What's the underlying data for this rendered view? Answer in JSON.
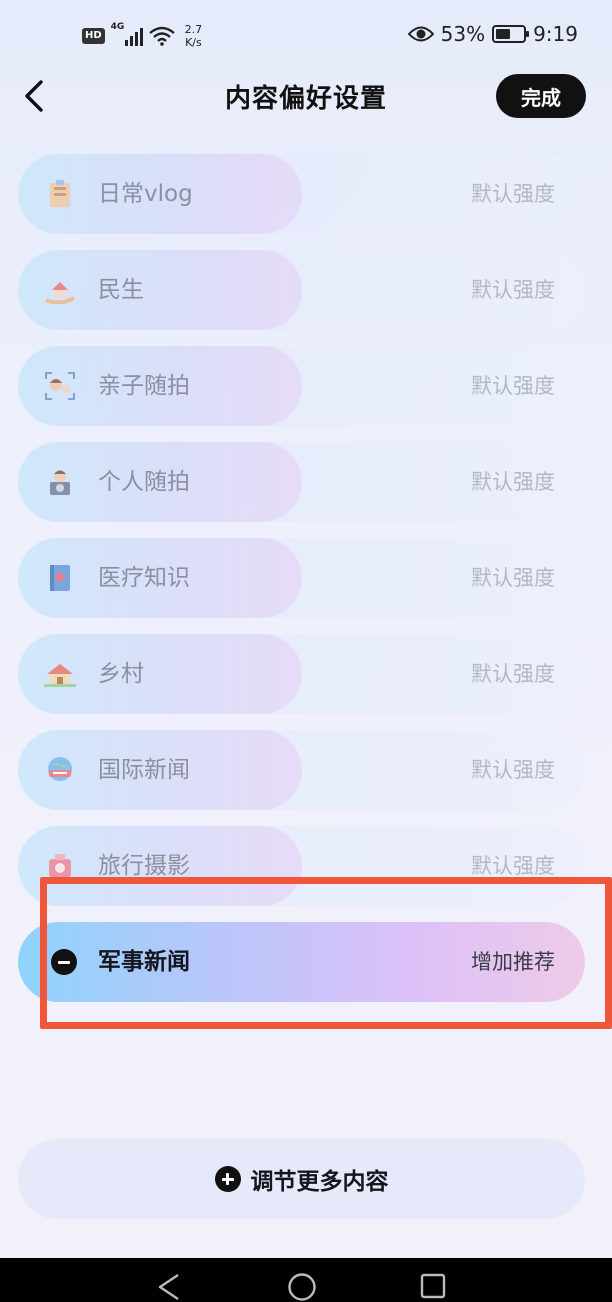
{
  "status_bar": {
    "hd": "HD",
    "network": "4G",
    "speed_value": "2.7",
    "speed_unit": "K/s",
    "battery_percent": "53%",
    "battery_level": 0.53,
    "time": "9:19",
    "icons": [
      "signal-icon",
      "wifi-icon",
      "eye-icon",
      "battery-icon"
    ]
  },
  "header": {
    "title": "内容偏好设置",
    "done_label": "完成",
    "back_icon": "back-chevron-icon"
  },
  "rows": [
    {
      "label": "日常vlog",
      "value": "默认强度",
      "icon": "vlog-icon"
    },
    {
      "label": "民生",
      "value": "默认强度",
      "icon": "house-hand-icon"
    },
    {
      "label": "亲子随拍",
      "value": "默认强度",
      "icon": "parent-child-icon"
    },
    {
      "label": "个人随拍",
      "value": "默认强度",
      "icon": "camera-person-icon"
    },
    {
      "label": "医疗知识",
      "value": "默认强度",
      "icon": "medical-book-icon"
    },
    {
      "label": "乡村",
      "value": "默认强度",
      "icon": "village-house-icon"
    },
    {
      "label": "国际新闻",
      "value": "默认强度",
      "icon": "globe-news-icon"
    },
    {
      "label": "旅行摄影",
      "value": "默认强度",
      "icon": "travel-camera-icon"
    }
  ],
  "active_row": {
    "label": "军事新闻",
    "value": "增加推荐",
    "icon": "minus-circle-icon"
  },
  "more_button": {
    "label": "调节更多内容",
    "icon": "plus-circle-icon"
  },
  "nav": {
    "icons": [
      "back-triangle-icon",
      "home-circle-icon",
      "recents-square-icon"
    ]
  },
  "colors": {
    "highlight": "#f0563a",
    "done_bg": "#111111",
    "accent_gradient_start": "#8fd3fb",
    "accent_gradient_end": "#efcbe8"
  }
}
